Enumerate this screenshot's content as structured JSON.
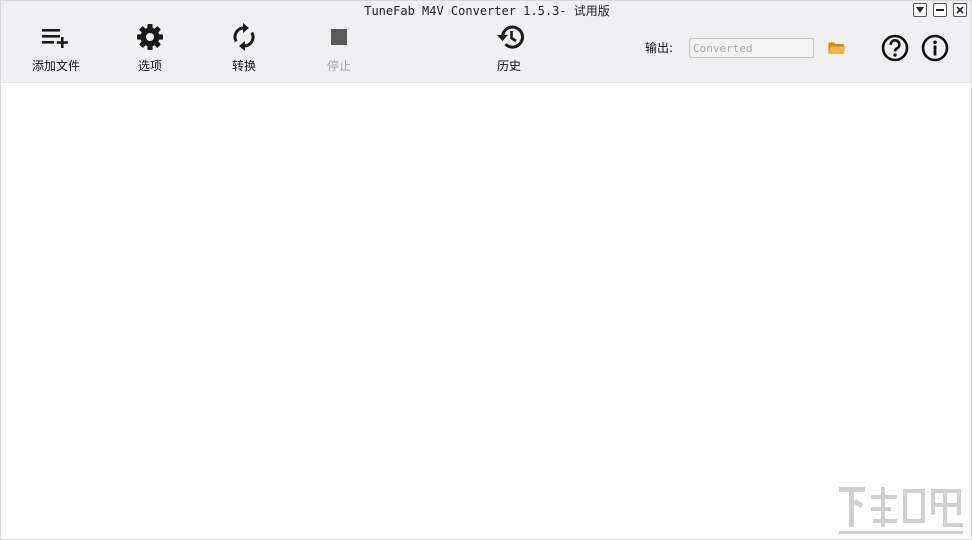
{
  "window": {
    "title": "TuneFab M4V Converter 1.5.3- 试用版"
  },
  "toolbar": {
    "add_files_label": "添加文件",
    "options_label": "选项",
    "convert_label": "转换",
    "stop_label": "停止",
    "history_label": "历史"
  },
  "output": {
    "label": "输出:",
    "placeholder": "Converted"
  },
  "colors": {
    "toolbar_bg": "#f0eff2",
    "icon": "#1a1a1a",
    "disabled_icon": "#5a5a5a",
    "disabled_text": "#a6a6a6",
    "folder": "#e0a33a"
  }
}
